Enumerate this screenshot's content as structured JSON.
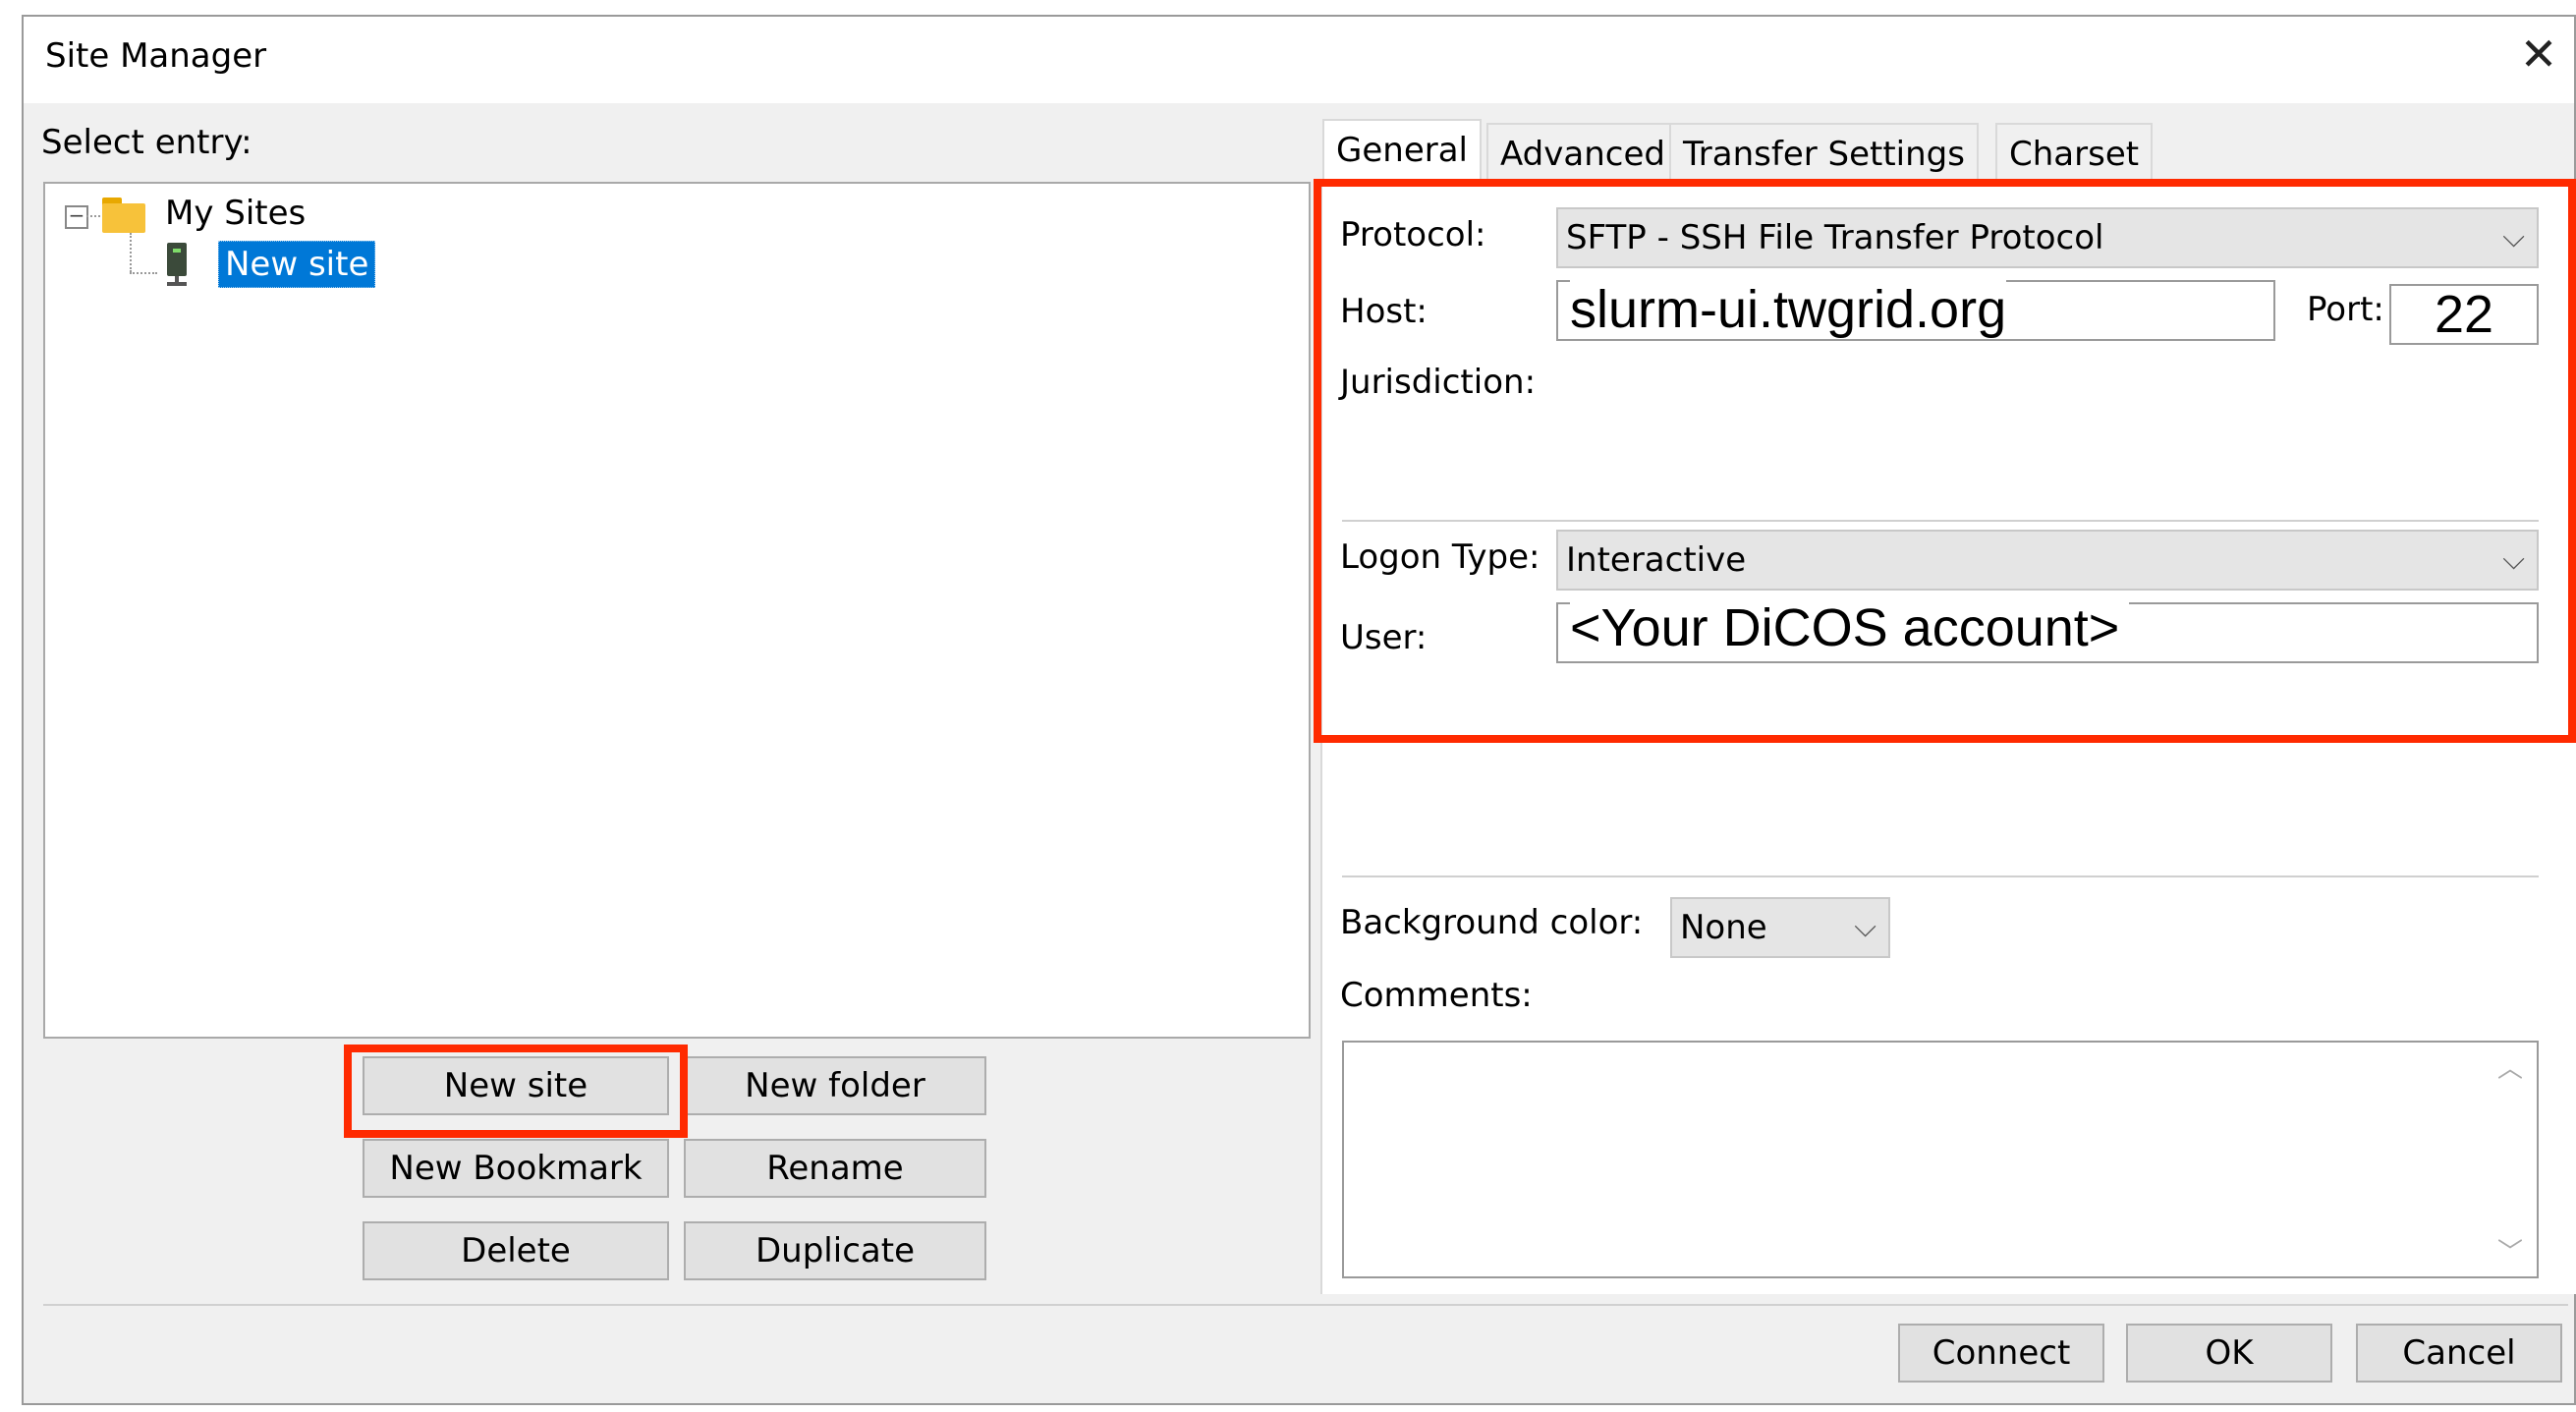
{
  "window": {
    "title": "Site Manager"
  },
  "left": {
    "select_entry_label": "Select entry:",
    "tree": [
      {
        "label": "My Sites",
        "icon": "folder-icon",
        "expanded": true
      },
      {
        "label": "New site",
        "icon": "server-icon",
        "selected": true
      }
    ],
    "buttons": {
      "new_site": "New site",
      "new_folder": "New folder",
      "new_bookmark": "New Bookmark",
      "rename": "Rename",
      "delete": "Delete",
      "duplicate": "Duplicate"
    }
  },
  "tabs": [
    "General",
    "Advanced",
    "Transfer Settings",
    "Charset"
  ],
  "general": {
    "protocol_label": "Protocol:",
    "protocol_value": "SFTP - SSH File Transfer Protocol",
    "host_label": "Host:",
    "host_value": "slurm-ui.twgrid.org",
    "port_label": "Port:",
    "port_value": "22",
    "jurisdiction_label": "Jurisdiction:",
    "logon_type_label": "Logon Type:",
    "logon_type_value": "Interactive",
    "user_label": "User:",
    "user_value": "<Your DiCOS account>",
    "bg_color_label": "Background color:",
    "bg_color_value": "None",
    "comments_label": "Comments:"
  },
  "footer": {
    "connect": "Connect",
    "ok": "OK",
    "cancel": "Cancel"
  },
  "colors": {
    "highlight": "#ff2a00",
    "selection": "#0078d7"
  }
}
